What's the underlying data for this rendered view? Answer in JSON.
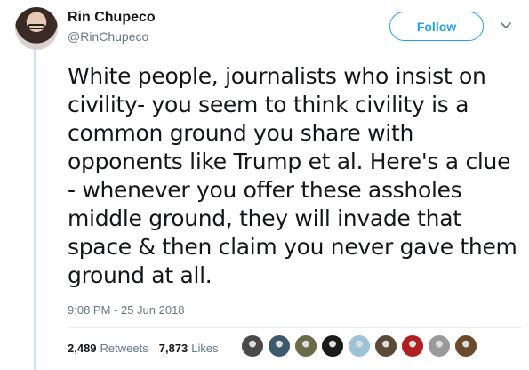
{
  "author": {
    "name": "Rin Chupeco",
    "handle": "@RinChupeco",
    "avatar_icon": "profile-photo"
  },
  "follow": {
    "label": "Follow",
    "accent": "#1da1f2"
  },
  "menu": {
    "icon": "chevron-down-icon"
  },
  "tweet": {
    "text": "White people, journalists who insist on\ncivility- you seem to think civility is a\ncommon ground you share with\nopponents like Trump et al. Here's a clue\n- whenever you offer these assholes\nmiddle ground, they will invade that\nspace & then claim you never gave them\nground at all.",
    "timestamp": "9:08 PM - 25 Jun 2018"
  },
  "stats": {
    "retweets_count": "2,489",
    "retweets_label": "Retweets",
    "likes_count": "7,873",
    "likes_label": "Likes"
  },
  "likers": [
    {
      "color": "#4a4a4a"
    },
    {
      "color": "#3d5a6c"
    },
    {
      "color": "#6b6b4a"
    },
    {
      "color": "#1a1a1a"
    },
    {
      "color": "#9cc3d8"
    },
    {
      "color": "#5a4a3a"
    },
    {
      "color": "#b02020"
    },
    {
      "color": "#9a9a9a"
    },
    {
      "color": "#6a4a2a"
    }
  ],
  "colors": {
    "text": "#14171a",
    "secondary": "#657786",
    "thread_line": "#c4e6f0"
  }
}
